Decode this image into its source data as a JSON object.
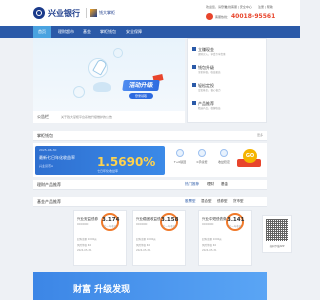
{
  "header": {
    "logo_text": "兴业银行",
    "logo_sub": "钱大掌柜",
    "login_link": "欢迎您，请登录",
    "support_link": "在线客服 | 安全中心",
    "register_link": "注册 | 帮助",
    "phone_label": "客服热线：",
    "phone_number": "40018-95561"
  },
  "nav": {
    "items": [
      {
        "label": "首页"
      },
      {
        "label": "理财超市"
      },
      {
        "label": "基金"
      },
      {
        "label": "掌柜钱包"
      },
      {
        "label": "安全保障"
      }
    ]
  },
  "banner": {
    "promo_title": "活动升级",
    "promo_sub": "登录领取",
    "announce_label": "公告栏",
    "announce_text": "关于钱大掌柜平台系统升级维护的公告"
  },
  "news": {
    "items": [
      {
        "title": "立赚现金",
        "desc": "理财买入，享受专享优惠"
      },
      {
        "title": "钱包升级",
        "desc": "全新升级，收益更高"
      },
      {
        "title": "轻松定投",
        "desc": "定投基金，省心省力"
      },
      {
        "title": "产品推荐",
        "desc": "精选产品，稳健收益"
      }
    ]
  },
  "fund_section": {
    "title": "掌柜钱包",
    "more": "更多",
    "date": "2025-06-30",
    "desc": "最新七日年化收益率",
    "code": "兴业货币A",
    "rate": "1.5690%",
    "rate_label": "七日年化收益率",
    "features": [
      {
        "label": "T+0赎回"
      },
      {
        "label": "0手续费"
      },
      {
        "label": "收益稳定"
      }
    ],
    "coin_text": "GO"
  },
  "finance_section": {
    "title": "理财产品推荐",
    "tabs": [
      {
        "label": "热门推荐"
      },
      {
        "label": "理财"
      },
      {
        "label": "基金"
      }
    ]
  },
  "fund_products": {
    "title": "基金产品推荐",
    "tabs": [
      {
        "label": "股票型"
      },
      {
        "label": "混合型"
      },
      {
        "label": "债券型"
      },
      {
        "label": "货币型"
      }
    ]
  },
  "cards": [
    {
      "name": "兴业安益债券",
      "code": "000000",
      "rate": "3.174",
      "rate_label": "近一年收益",
      "line1": "起购金额 1000元",
      "line2": "风险等级 R2",
      "line3": "2024-05-31"
    },
    {
      "name": "兴业稳固收益债券",
      "code": "000000",
      "rate": "3.158",
      "rate_label": "近一年收益",
      "line1": "起购金额 1000元",
      "line2": "风险等级 R2",
      "line3": "2024-05-31"
    },
    {
      "name": "兴业中短债债券",
      "code": "000000",
      "rate": "3.141",
      "rate_label": "近一年收益",
      "line1": "起购金额 1000元",
      "line2": "风险等级 R2",
      "line3": "2024-05-31"
    }
  ],
  "qr": {
    "label": "扫码下载APP"
  },
  "bottom_banner": {
    "text": "财富 升级发现"
  },
  "colors": {
    "brand": "#2b5aa8",
    "accent": "#e8452c",
    "highlight": "#f07a2b"
  }
}
